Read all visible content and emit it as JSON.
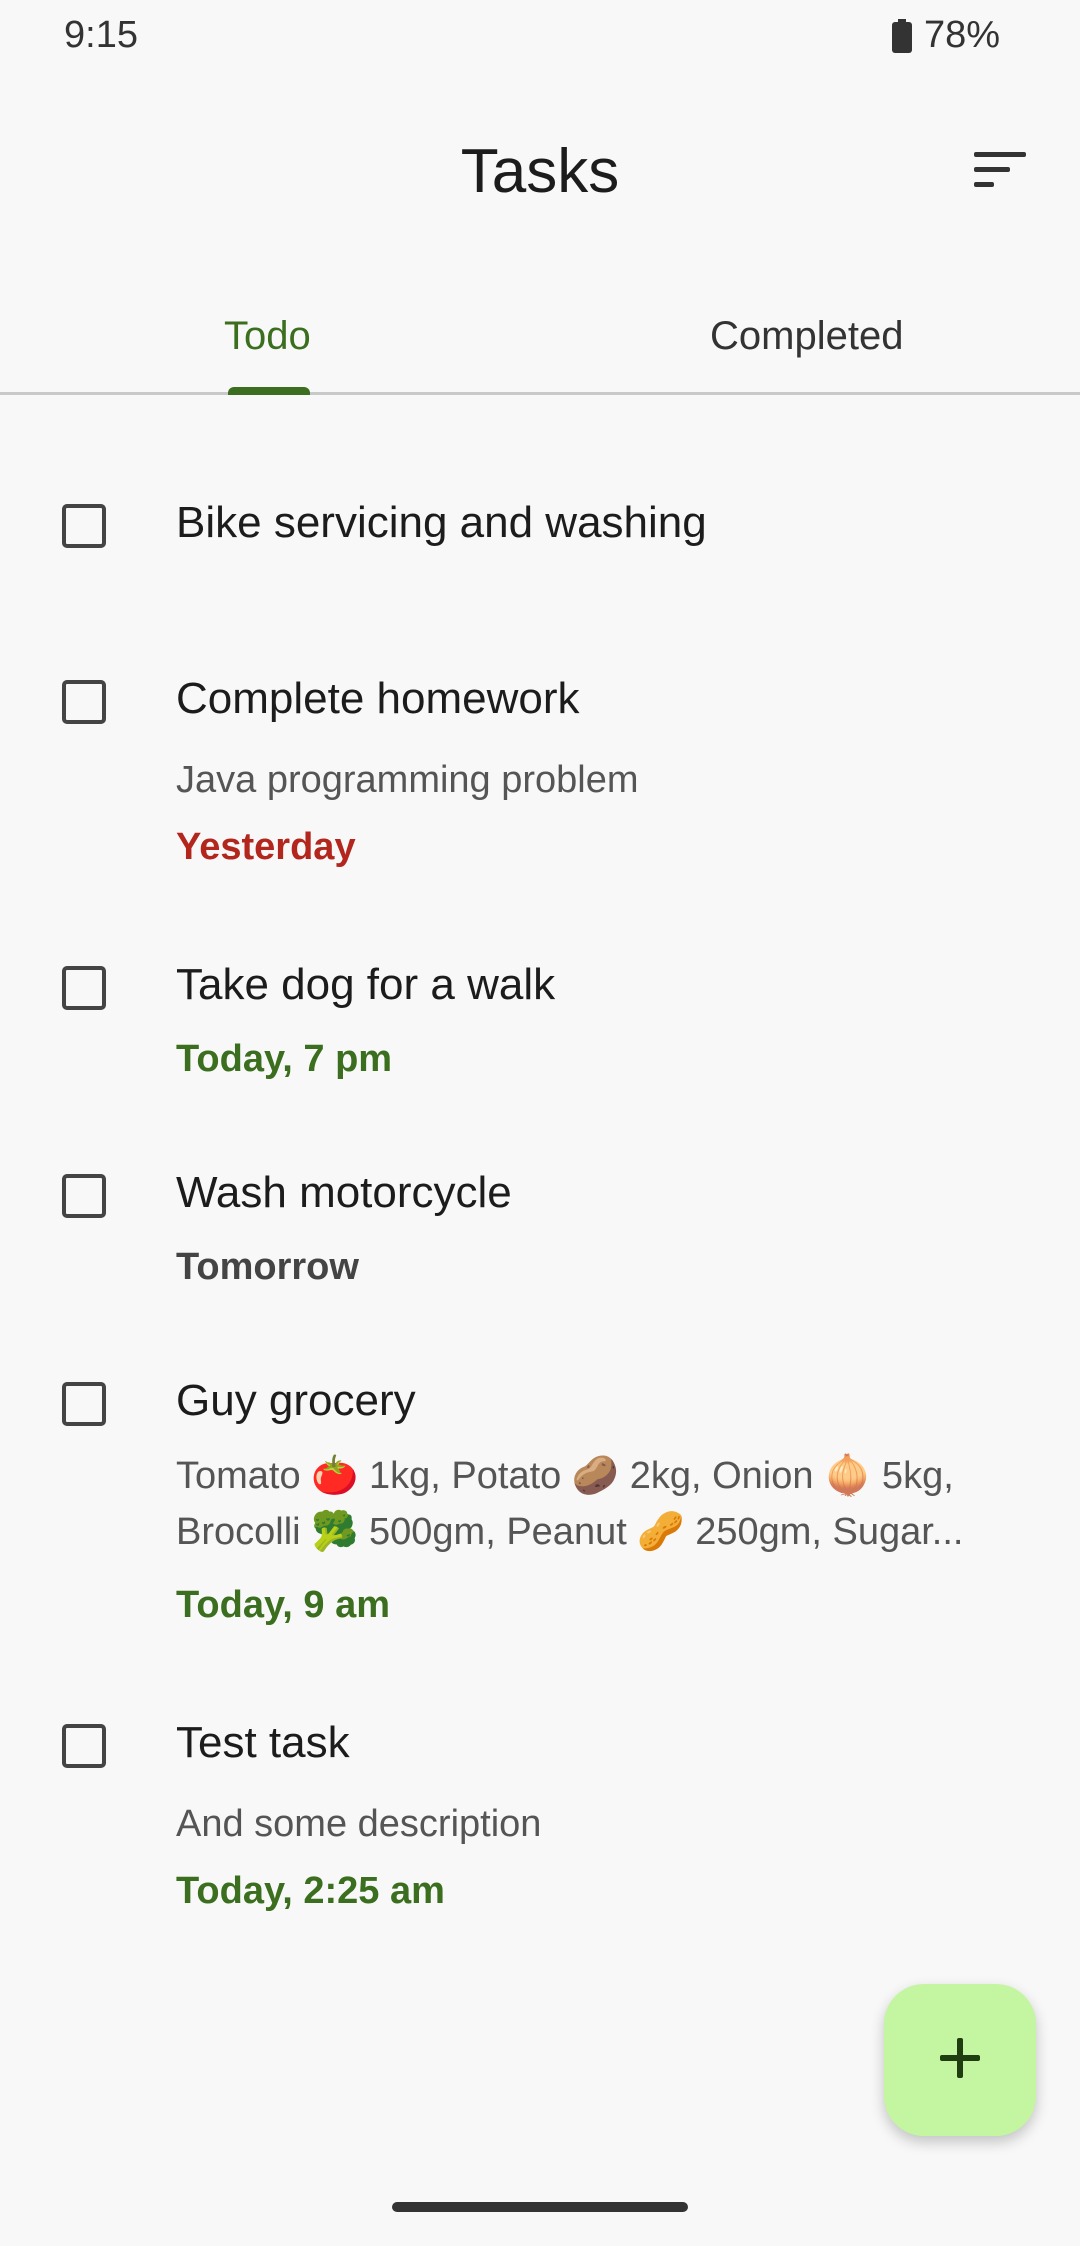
{
  "status_bar": {
    "time": "9:15",
    "battery": "78%",
    "battery_icon": "battery-icon"
  },
  "app_bar": {
    "title": "Tasks",
    "sort_icon": "sort-icon"
  },
  "tabs": [
    {
      "label": "Todo",
      "selected": true
    },
    {
      "label": "Completed",
      "selected": false
    }
  ],
  "tasks": [
    {
      "title": "Bike servicing and washing",
      "description": "",
      "due": "",
      "due_status": ""
    },
    {
      "title": "Complete homework",
      "description": "Java programming problem",
      "due": "Yesterday",
      "due_status": "overdue"
    },
    {
      "title": "Take dog for a walk",
      "description": "",
      "due": "Today, 7 pm",
      "due_status": "today"
    },
    {
      "title": "Wash motorcycle",
      "description": "",
      "due": "Tomorrow",
      "due_status": "future"
    },
    {
      "title": "Guy grocery",
      "description": "Tomato 🍅 1kg, Potato 🥔 2kg, Onion 🧅 5kg, Brocolli 🥦 500gm, Peanut 🥜 250gm, Sugar...",
      "due": "Today, 9 am",
      "due_status": "today"
    },
    {
      "title": "Test task",
      "description": "And some description",
      "due": "Today, 2:25 am",
      "due_status": "today"
    }
  ],
  "fab": {
    "icon": "plus-icon"
  },
  "colors": {
    "accent": "#3b6e1e",
    "overdue": "#b3261e",
    "fab_background": "#c4f5a0",
    "background": "#f8f8f8"
  }
}
